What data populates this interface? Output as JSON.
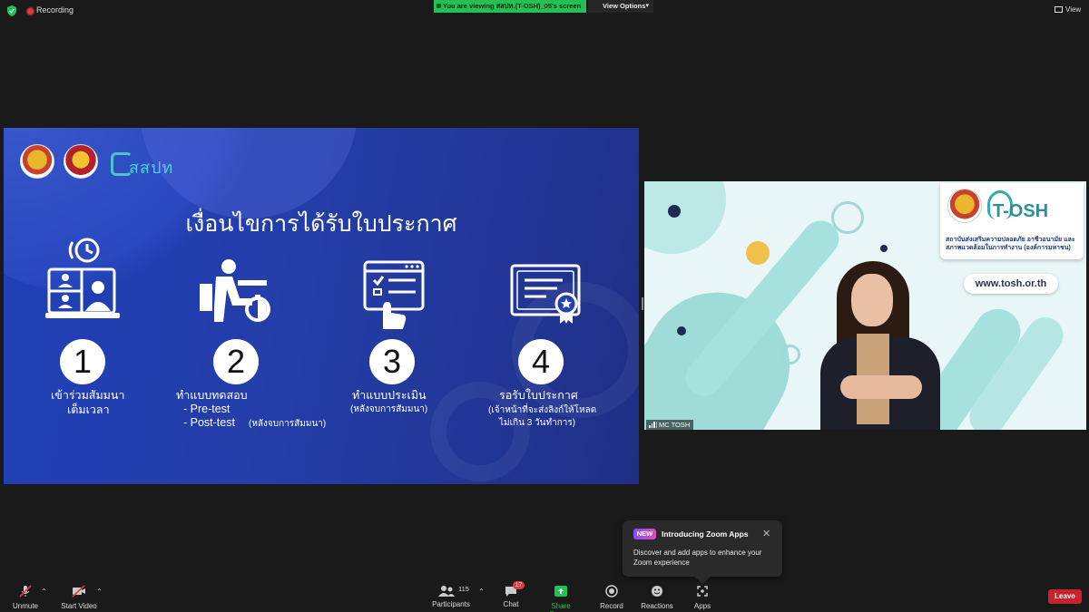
{
  "top_bar": {
    "recording_label": "Recording",
    "viewing_text": "You are viewing สสปท.(T-OSH)_05's screen",
    "view_options_label": "View Options",
    "view_label": "View"
  },
  "slide": {
    "logo_text": "สสปท",
    "title": "เงื่อนไขการได้รับใบประกาศ",
    "steps": [
      {
        "number": "1",
        "label_line1": "เข้าร่วมสัมมนา",
        "label_line2": "เต็มเวลา"
      },
      {
        "number": "2",
        "label_line1": "ทำแบบทดสอบ",
        "label_line2": "- Pre-test",
        "label_line3": "- Post-test",
        "label_note": "(หลังจบการสัมมนา)"
      },
      {
        "number": "3",
        "label_line1": "ทำแบบประเมิน",
        "label_note": "(หลังจบการสัมมนา)"
      },
      {
        "number": "4",
        "label_line1": "รอรับใบประกาศ",
        "label_note1": "(เจ้าหน้าที่จะส่งลิงก์ให้โหลด",
        "label_note2": "ไม่เกิน 3 วันทำการ)"
      }
    ]
  },
  "video": {
    "brand": "T-OSH",
    "org_name": "สถาบันส่งเสริมความปลอดภัย อาชีวอนามัย และสภาพแวดล้อมในการทำงาน (องค์การมหาชน)",
    "url": "www.tosh.or.th",
    "participant_name": "MC TOSH"
  },
  "popup": {
    "badge": "NEW",
    "title": "Introducing Zoom Apps",
    "body": "Discover and add apps to enhance your Zoom experience"
  },
  "toolbar": {
    "unmute": "Unmute",
    "start_video": "Start Video",
    "participants": "Participants",
    "participants_count": "115",
    "chat": "Chat",
    "chat_badge": "17",
    "share_screen": "Share Screen",
    "record": "Record",
    "reactions": "Reactions",
    "apps": "Apps",
    "leave": "Leave"
  },
  "colors": {
    "share_green": "#23c053",
    "leave_red": "#c8232c",
    "slide_blue": "#2440b0"
  }
}
